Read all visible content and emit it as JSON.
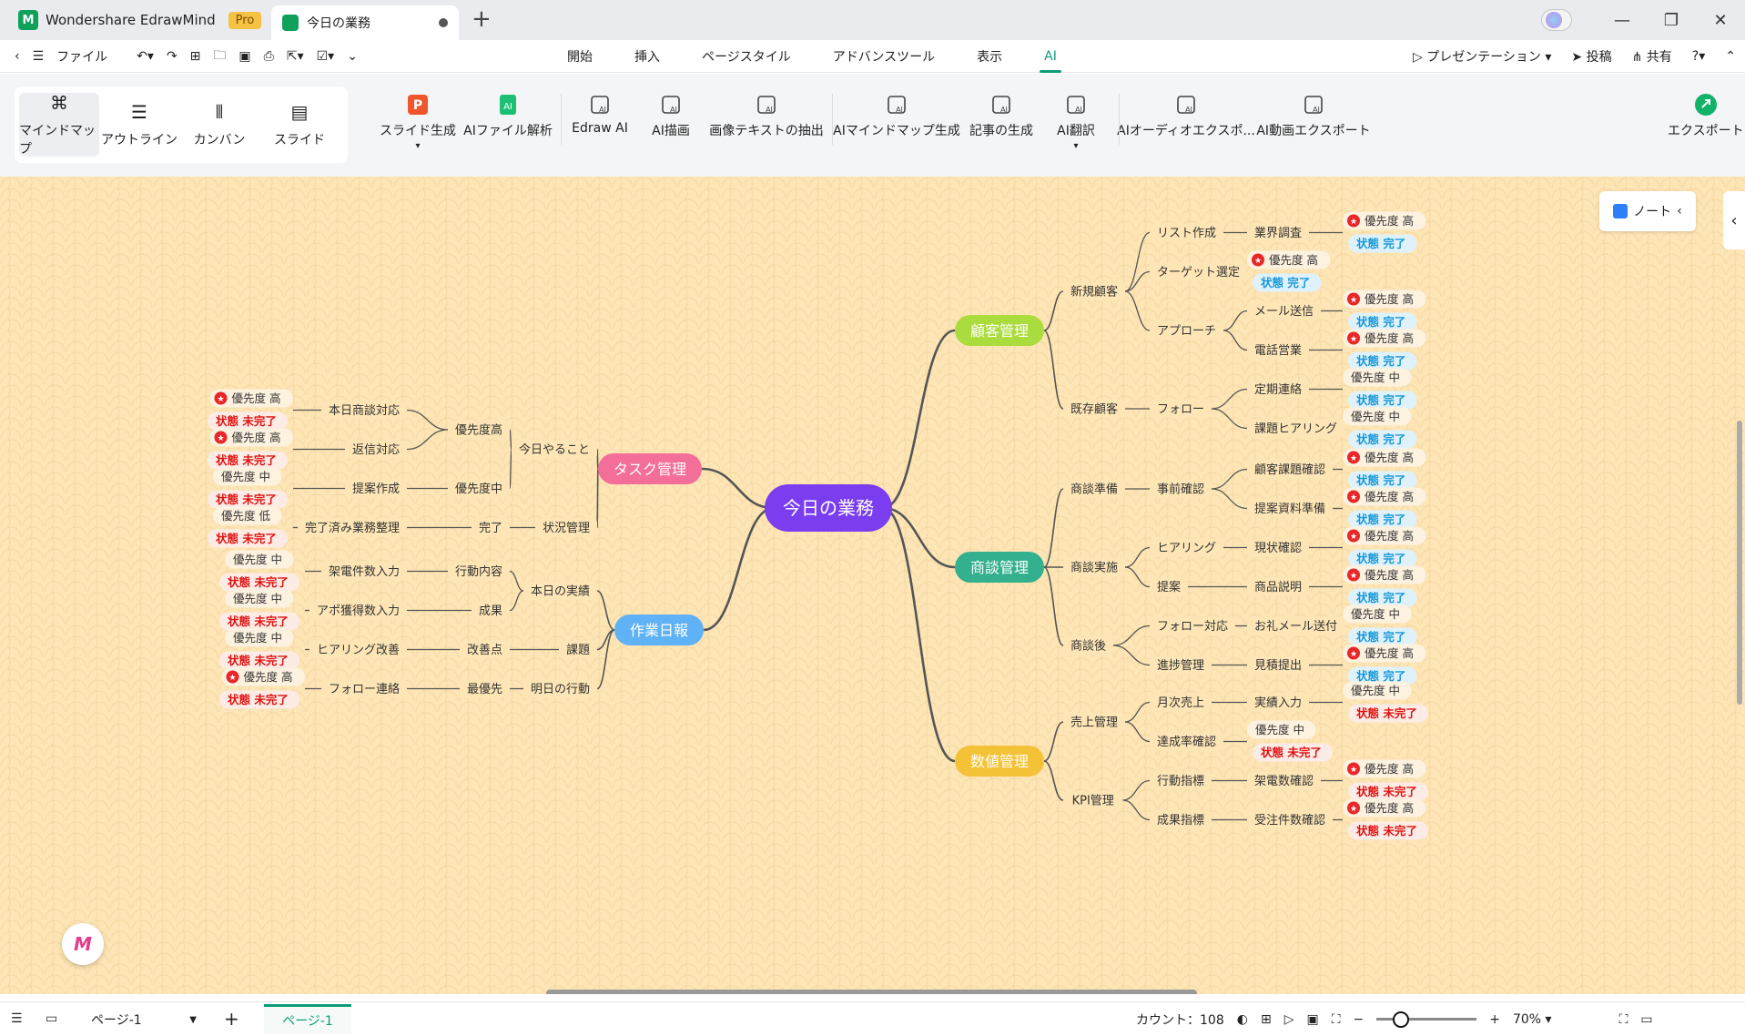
{
  "app": {
    "name": "Wondershare EdrawMind",
    "badge": "Pro",
    "doc_tab": "今日の業務"
  },
  "menubar": {
    "file": "ファイル",
    "tabs": [
      "開始",
      "挿入",
      "ページスタイル",
      "アドバンスツール",
      "表示",
      "AI"
    ],
    "active_tab": "AI",
    "right": [
      "プレゼンテーション",
      "投稿",
      "共有"
    ]
  },
  "ribbon": {
    "views": [
      "マインドマップ",
      "アウトライン",
      "カンバン",
      "スライド"
    ],
    "active_view": "マインドマップ",
    "tools": [
      "スライド生成",
      "AIファイル解析",
      "Edraw AI",
      "AI描画",
      "画像テキストの抽出",
      "AIマインドマップ生成",
      "記事の生成",
      "AI翻訳",
      "AIオーディオエクスポ...",
      "AI動画エクスポート"
    ],
    "export": "エクスポート"
  },
  "note_button": "ノート",
  "mindmap": {
    "root": "今日の業務",
    "labels": {
      "priority": "優先度",
      "status": "状態",
      "high": "高",
      "mid": "中",
      "low": "低",
      "done": "完了",
      "undone": "未完了"
    },
    "branches": [
      {
        "name": "顧客管理",
        "color": "#a9dc3c",
        "children": [
          {
            "name": "新規顧客",
            "children": [
              {
                "name": "リスト作成",
                "children": [
                  {
                    "name": "業界調査",
                    "priority": "高",
                    "status": "完了"
                  }
                ]
              },
              {
                "name": "ターゲット選定",
                "priority": "高",
                "status": "完了"
              },
              {
                "name": "アプローチ",
                "children": [
                  {
                    "name": "メール送信",
                    "priority": "高",
                    "status": "完了"
                  },
                  {
                    "name": "電話営業",
                    "priority": "高",
                    "status": "完了"
                  }
                ]
              }
            ]
          },
          {
            "name": "既存顧客",
            "children": [
              {
                "name": "フォロー",
                "children": [
                  {
                    "name": "定期連絡",
                    "priority": "中",
                    "status": "完了"
                  },
                  {
                    "name": "課題ヒアリング",
                    "priority": "中",
                    "status": "完了"
                  }
                ]
              }
            ]
          }
        ]
      },
      {
        "name": "商談管理",
        "color": "#33b08d",
        "children": [
          {
            "name": "商談準備",
            "children": [
              {
                "name": "事前確認",
                "children": [
                  {
                    "name": "顧客課題確認",
                    "priority": "高",
                    "status": "完了"
                  },
                  {
                    "name": "提案資料準備",
                    "priority": "高",
                    "status": "完了"
                  }
                ]
              }
            ]
          },
          {
            "name": "商談実施",
            "children": [
              {
                "name": "ヒアリング",
                "children": [
                  {
                    "name": "現状確認",
                    "priority": "高",
                    "status": "完了"
                  }
                ]
              },
              {
                "name": "提案",
                "children": [
                  {
                    "name": "商品説明",
                    "priority": "高",
                    "status": "完了"
                  }
                ]
              }
            ]
          },
          {
            "name": "商談後",
            "children": [
              {
                "name": "フォロー対応",
                "children": [
                  {
                    "name": "お礼メール送付",
                    "priority": "中",
                    "status": "完了"
                  }
                ]
              },
              {
                "name": "進捗管理",
                "children": [
                  {
                    "name": "見積提出",
                    "priority": "高",
                    "status": "完了"
                  }
                ]
              }
            ]
          }
        ]
      },
      {
        "name": "数値管理",
        "color": "#f4c236",
        "children": [
          {
            "name": "売上管理",
            "children": [
              {
                "name": "月次売上",
                "children": [
                  {
                    "name": "実績入力",
                    "priority": "中",
                    "status": "未完了"
                  }
                ]
              },
              {
                "name": "達成率確認",
                "priority": "中",
                "status": "未完了"
              }
            ]
          },
          {
            "name": "KPI管理",
            "children": [
              {
                "name": "行動指標",
                "children": [
                  {
                    "name": "架電数確認",
                    "priority": "高",
                    "status": "未完了"
                  }
                ]
              },
              {
                "name": "成果指標",
                "children": [
                  {
                    "name": "受注件数確認",
                    "priority": "高",
                    "status": "未完了"
                  }
                ]
              }
            ]
          }
        ]
      },
      {
        "name": "タスク管理",
        "color": "#f36e99",
        "children": [
          {
            "name": "今日やること",
            "children": [
              {
                "name": "優先度高",
                "children": [
                  {
                    "name": "本日商談対応",
                    "priority": "高",
                    "status": "未完了"
                  },
                  {
                    "name": "返信対応",
                    "priority": "高",
                    "status": "未完了"
                  }
                ]
              },
              {
                "name": "優先度中",
                "children": [
                  {
                    "name": "提案作成",
                    "priority": "中",
                    "status": "未完了"
                  }
                ]
              }
            ]
          },
          {
            "name": "状況管理",
            "children": [
              {
                "name": "完了",
                "children": [
                  {
                    "name": "完了済み業務整理",
                    "priority": "低",
                    "status": "未完了"
                  }
                ]
              }
            ]
          }
        ]
      },
      {
        "name": "作業日報",
        "color": "#5fb2f5",
        "children": [
          {
            "name": "本日の実績",
            "children": [
              {
                "name": "行動内容",
                "children": [
                  {
                    "name": "架電件数入力",
                    "priority": "中",
                    "status": "未完了"
                  }
                ]
              },
              {
                "name": "成果",
                "children": [
                  {
                    "name": "アポ獲得数入力",
                    "priority": "中",
                    "status": "未完了"
                  }
                ]
              }
            ]
          },
          {
            "name": "課題",
            "children": [
              {
                "name": "改善点",
                "children": [
                  {
                    "name": "ヒアリング改善",
                    "priority": "中",
                    "status": "未完了"
                  }
                ]
              }
            ]
          },
          {
            "name": "明日の行動",
            "children": [
              {
                "name": "最優先",
                "children": [
                  {
                    "name": "フォロー連絡",
                    "priority": "高",
                    "status": "未完了"
                  }
                ]
              }
            ]
          }
        ]
      }
    ]
  },
  "statusbar": {
    "page_selector": "ページ-1",
    "page_tab": "ページ-1",
    "count_label": "カウント：",
    "count": "108",
    "zoom": "70%"
  }
}
